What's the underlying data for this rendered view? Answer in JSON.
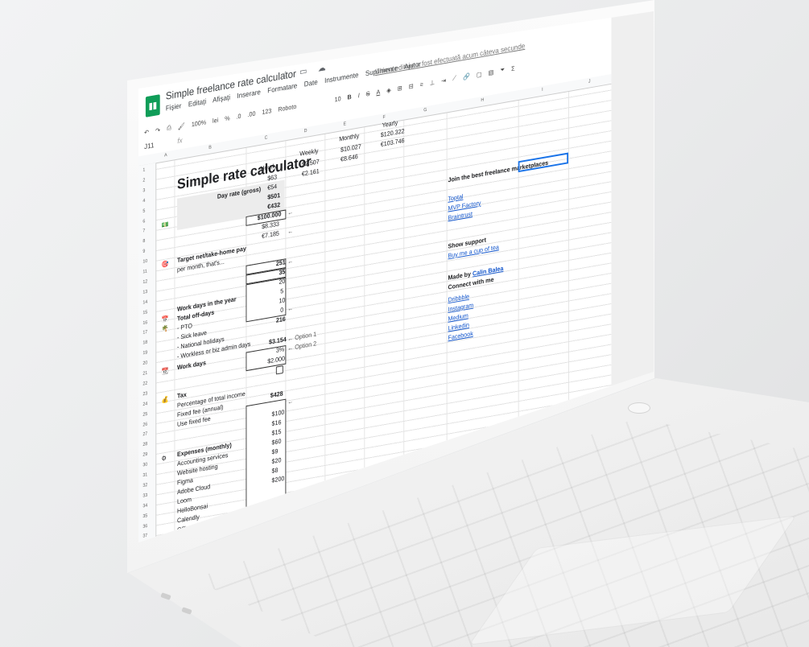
{
  "app": {
    "doc_title": "Simple freelance rate calculator",
    "menu": [
      "Fișier",
      "Editați",
      "Afișați",
      "Inserare",
      "Formatare",
      "Date",
      "Instrumente",
      "Suplimente",
      "Ajutor"
    ],
    "last_edit": "Ultima editare a fost efectuată acum câteva secunde",
    "toolbar": {
      "zoom": "100%",
      "currency": "lei",
      "percent": "%",
      "dec_less": ".0",
      "dec_more": ".00",
      "format": "123",
      "font": "Roboto",
      "size": "10",
      "bold": "B",
      "italic": "I",
      "strike": "S",
      "color": "A",
      "sum": "Σ"
    },
    "cell_ref": "J11",
    "fx": "fx"
  },
  "columns": [
    "A",
    "B",
    "C",
    "D",
    "E",
    "F",
    "G",
    "H",
    "I",
    "J"
  ],
  "rows": [
    "1",
    "2",
    "3",
    "4",
    "5",
    "6",
    "7",
    "8",
    "9",
    "10",
    "11",
    "12",
    "13",
    "14",
    "15",
    "16",
    "17",
    "18",
    "19",
    "20",
    "21",
    "22",
    "23",
    "24",
    "25",
    "26",
    "27",
    "28",
    "29",
    "30",
    "31",
    "32",
    "33",
    "34",
    "35",
    "36",
    "37"
  ],
  "calc": {
    "title": "Simple rate calculator",
    "headers": {
      "hourly": "Hourly",
      "weekly": "Weekly",
      "monthly": "Monthly",
      "yearly": "Yearly"
    },
    "day_rate_label": "Day rate (gross)",
    "day_rate_gross": "$501",
    "day_rate_net": "€432",
    "hourly_gross": "$63",
    "hourly_net": "€54",
    "weekly_gross": "$2.507",
    "weekly_net": "€2.161",
    "monthly_gross": "$10.027",
    "monthly_net": "€8.646",
    "yearly_gross": "$120.322",
    "yearly_net": "€103.746",
    "target_label": "Target net/take-home pay",
    "per_month_label": "per month, that's...",
    "target_value": "$100.000",
    "target_month": "$8.333",
    "target_eur": "€7.185",
    "workdays_label": "Work days in the year",
    "workdays": "251",
    "offdays_label": "Total off-days",
    "offdays": "35",
    "pto_label": "- PTO",
    "pto": "20",
    "sick_label": "- Sick leave",
    "sick": "5",
    "holidays_label": "- National holidays",
    "holidays": "10",
    "workless_label": "- Workless  or biz admin days",
    "workless": "0",
    "workdays_net_label": "Work days",
    "workdays_net": "216",
    "tax_label": "Tax",
    "tax_total": "$3.154",
    "tax_pct_label": "Percentage of total income",
    "tax_pct": "3%",
    "fixed_label": "Fixed fee (annual)",
    "fixed_fee": "$2.000",
    "use_fixed_label": "Use fixed fee",
    "option1": "← Option 1",
    "option2": "← Option 2",
    "expenses_label": "Expenses (monthly)",
    "expenses_total": "$428",
    "expenses": [
      {
        "name": "Accounting services",
        "value": "$100"
      },
      {
        "name": "Website hosting",
        "value": "$16"
      },
      {
        "name": "Figma",
        "value": "$15"
      },
      {
        "name": "Adobe Cloud",
        "value": "$60"
      },
      {
        "name": "Loom",
        "value": "$9"
      },
      {
        "name": "HelloBonsai",
        "value": "$20"
      },
      {
        "name": "Calendly",
        "value": "$8"
      },
      {
        "name": "Office space",
        "value": "$200"
      }
    ]
  },
  "side": {
    "join_label": "Join the best freelance marketplaces",
    "marketplaces": [
      "Toptal",
      "MVP Factory",
      "Braintrust"
    ],
    "support_label": "Show support",
    "support_link": "Buy me a cup of tea",
    "made_by_label": "Made by",
    "author": "Calin Balea",
    "connect_label": "Connect with me",
    "social": [
      "Dribbble",
      "Instagram",
      "Medium",
      "Linkedin",
      "Facebook"
    ]
  }
}
